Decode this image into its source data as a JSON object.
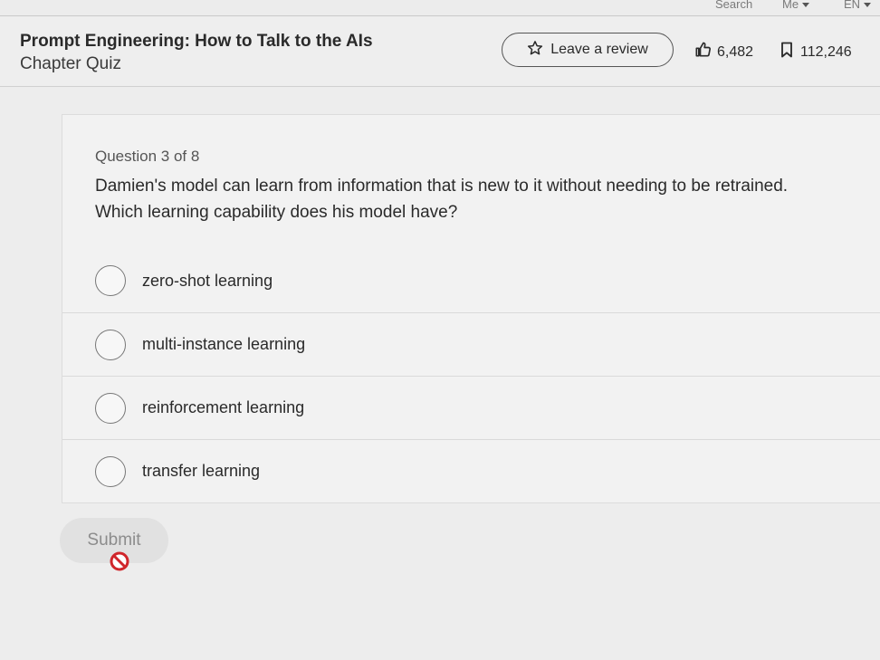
{
  "topbar": {
    "search": "Search",
    "me": "Me",
    "language": "EN"
  },
  "header": {
    "course_title": "Prompt Engineering: How to Talk to the AIs",
    "subtitle": "Chapter Quiz",
    "review_label": "Leave a review",
    "likes": "6,482",
    "saves": "112,246"
  },
  "quiz": {
    "counter": "Question 3 of 8",
    "question_line1": "Damien's model can learn from information that is new to it without needing to be retrained.",
    "question_line2": "Which learning capability does his model have?",
    "options": [
      {
        "label": "zero-shot learning"
      },
      {
        "label": "multi-instance learning"
      },
      {
        "label": "reinforcement learning"
      },
      {
        "label": "transfer learning"
      }
    ],
    "submit_label": "Submit"
  },
  "icons": {
    "star": "star-icon",
    "like": "thumbs-up-icon",
    "save": "bookmark-icon",
    "cursor": "not-allowed-cursor-icon"
  },
  "colors": {
    "background": "#ededed",
    "not_allowed_red": "#d0262b"
  }
}
